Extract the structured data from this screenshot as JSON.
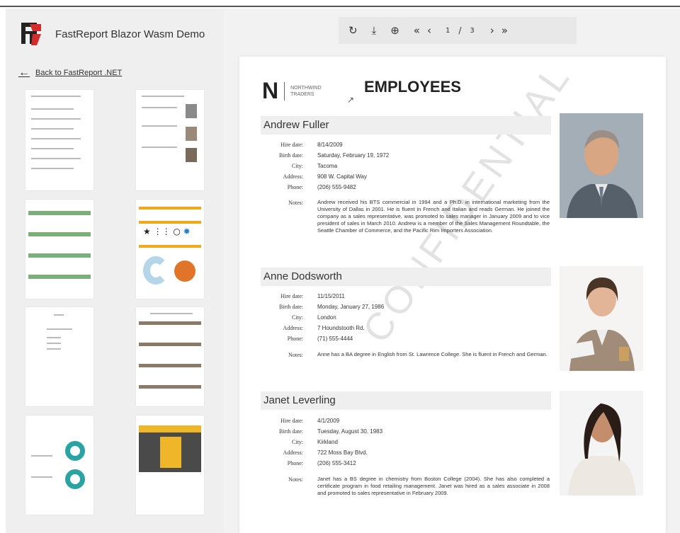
{
  "app": {
    "title": "FastReport Blazor Wasm Demo",
    "back_link": "Back to FastReport .NET"
  },
  "toolbar": {
    "icons": [
      "refresh-icon",
      "download-icon",
      "zoom-in-icon",
      "first-page-icon",
      "prev-page-icon",
      "next-page-icon",
      "last-page-icon"
    ],
    "first": "«",
    "prev": "‹",
    "next": "›",
    "last": "»",
    "page_current": "1",
    "page_sep": "/",
    "page_total": "3"
  },
  "report": {
    "logo_letter": "N",
    "logo_line1": "NORTHWIND",
    "logo_line2": "TRADERS",
    "title": "EMPLOYEES",
    "watermark": "CONFIDENTIAL",
    "labels": {
      "hire": "Hire date:",
      "birth": "Birth date:",
      "city": "City:",
      "address": "Address:",
      "phone": "Phone:",
      "notes": "Notes:"
    },
    "employees": [
      {
        "name": "Andrew Fuller",
        "hire": "8/14/2009",
        "birth": "Saturday, February 19, 1972",
        "city": "Tacoma",
        "address": "908 W. Capital Way",
        "phone": "(206) 555-9482",
        "notes": "Andrew received his BTS commercial in 1994 and a Ph.D. in international marketing from the University of Dallas in 2001. He is fluent in French and Italian and reads German. He joined the company as a sales representative, was promoted to sales manager in January 2009 and to vice president of sales in March 2010. Andrew is a member of the Sales Management Roundtable, the Seattle Chamber of Commerce, and the Pacific Rim Importers Association."
      },
      {
        "name": "Anne Dodsworth",
        "hire": "11/15/2011",
        "birth": "Monday, January 27, 1986",
        "city": "London",
        "address": "7 Houndstooth Rd.",
        "phone": "(71) 555-4444",
        "notes": "Anne has a BA degree in English from St. Lawrence College. She is fluent in French and German."
      },
      {
        "name": "Janet Leverling",
        "hire": "4/1/2009",
        "birth": "Tuesday, August 30, 1983",
        "city": "Kirkland",
        "address": "722 Moss Bay Blvd.",
        "phone": "(206) 555-3412",
        "notes": "Janet has a BS degree in chemistry from Boston College (2004). She has also completed a certificate program in food retailing management. Janet was hired as a sales associate in 2008 and promoted to sales representative in February 2009."
      }
    ]
  },
  "colors": {
    "logo_red": "#d42b2b",
    "logo_dark": "#222222",
    "sidebar_bg": "#efefef",
    "page_bg": "#ffffff"
  }
}
